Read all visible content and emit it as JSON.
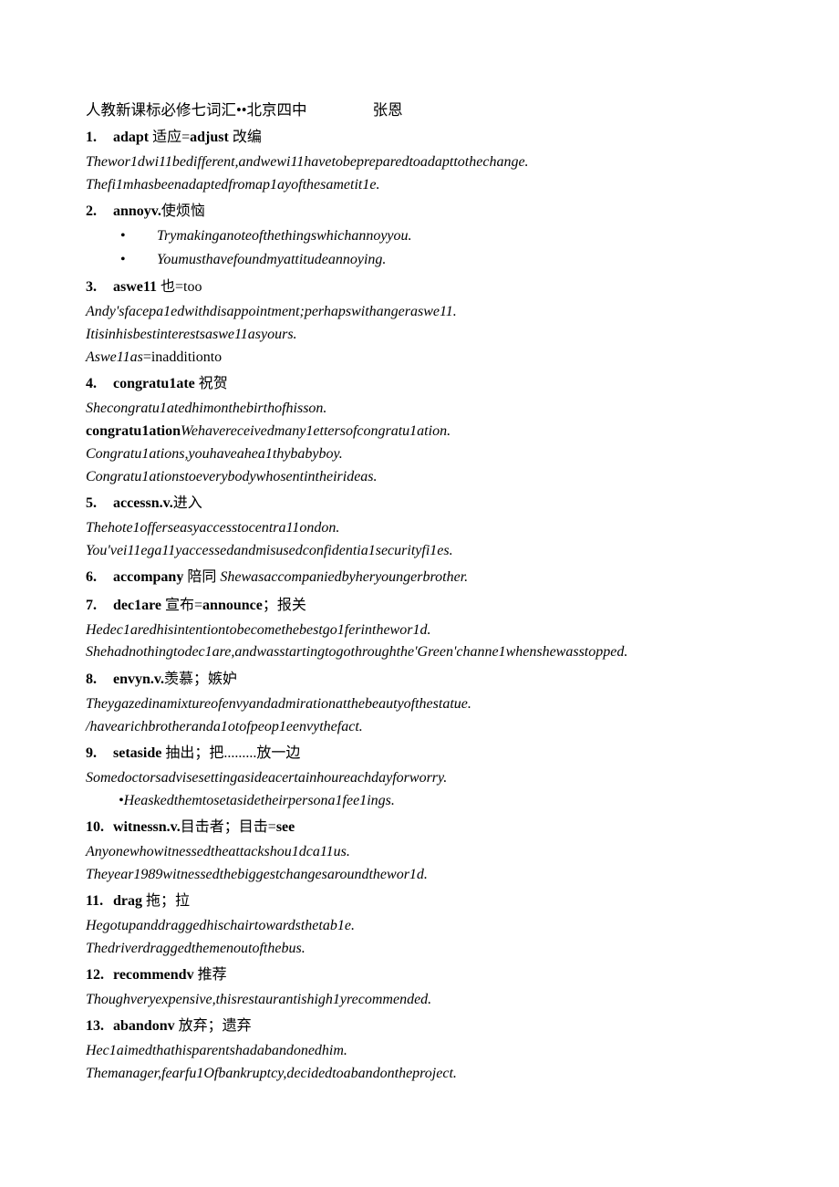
{
  "header": {
    "title": "人教新课标必修七词汇••北京四中",
    "author": "张恩"
  },
  "entries": [
    {
      "num": "1.",
      "word": "adapt",
      "gloss": " 适应=",
      "word2": "adjust",
      "gloss2": " 改编",
      "lines": [
        "Thewor1dwi11bedifferent,andwewi11havetobepreparedtoadapttothechange.",
        "Thefi1mhasbeenadaptedfromap1ayofthesametit1e."
      ]
    },
    {
      "num": "2.",
      "word": "annoyv.",
      "gloss": "使烦恼",
      "bullets": [
        "Trymakinganoteofthethingswhichannoyyou.",
        "Youmusthavefoundmyattitudeannoying."
      ]
    },
    {
      "num": "3.",
      "word": "aswe11",
      "gloss": " 也=too",
      "lines": [
        "Andy'sfacepa1edwithdisappointment;perhapswithangeraswe11.",
        "Itisinhisbestinterestsaswe11asyours."
      ],
      "mixed_line": {
        "italic": "Aswe11as",
        "plain": "=inadditionto"
      }
    },
    {
      "num": "4.",
      "word": "congratu1ate",
      "gloss": " 祝贺",
      "lines": [
        "Shecongratu1atedhimonthebirthofhisson."
      ],
      "runin_line": {
        "bold": "congratu1ation",
        "italic": "Wehavereceivedmany1ettersofcongratu1ation."
      },
      "lines_after": [
        "Congratu1ations,youhaveahea1thybabyboy.",
        "Congratu1ationstoeverybodywhosentintheirideas."
      ]
    },
    {
      "num": "5.",
      "word": "accessn.v.",
      "gloss": "进入",
      "lines": [
        "Thehote1offerseasyaccesstocentra11ondon.",
        "You'vei11ega11yaccessedandmisusedconfidentia1securityfi1es."
      ]
    },
    {
      "num": "6.",
      "word": "accompany",
      "gloss": " 陪同 ",
      "inline_example": "Shewasaccompaniedbyheryoungerbrother."
    },
    {
      "num": "7.",
      "word": "dec1are",
      "gloss": " 宣布=",
      "word2": "announce",
      "gloss2": "；报关",
      "lines": [
        "Hedec1aredhisintentiontobecomethebestgo1ferinthewor1d.",
        "Shehadnothingtodec1are,andwasstartingtogothroughthe'Green'channe1whenshewasstopped."
      ]
    },
    {
      "num": "8.",
      "word": "envyn.v.",
      "gloss": "羡慕；嫉妒",
      "lines": [
        "Theygazedinamixtureofenvyandadmirationatthebeautyofthestatue.",
        "/havearichbrotheranda1otofpeop1eenvythefact."
      ]
    },
    {
      "num": "9.",
      "word": "setaside",
      "gloss": " 抽出；把.........放一边",
      "lines": [
        "Somedoctorsadvisesettingasideacertainhoureachdayforworry."
      ],
      "tight_bullet": "•Heaskedthemtosetasidetheirpersona1fee1ings."
    },
    {
      "num": "10.",
      "word": "witnessn.v.",
      "gloss": "目击者；目击=",
      "word2": "see",
      "lines": [
        "Anyonewhowitnessedtheattackshou1dca11us.",
        "Theyear1989witnessedthebiggestchangesaroundthewor1d."
      ]
    },
    {
      "num": "11.",
      "word": "drag",
      "gloss": " 拖；拉",
      "lines": [
        "Hegotupanddraggedhischairtowardsthetab1e.",
        "Thedriverdraggedthemenoutofthebus."
      ]
    },
    {
      "num": "12.",
      "word": "recommendv",
      "gloss": " 推荐",
      "lines": [
        "Thoughveryexpensive,thisrestaurantishigh1yrecommended."
      ]
    },
    {
      "num": "13.",
      "word": "abandonv",
      "gloss": " 放弃；遗弃",
      "lines": [
        "Hec1aimedthathisparentshadabandonedhim.",
        "Themanager,fearfu1Ofbankruptcy,decidedtoabandontheproject."
      ]
    }
  ]
}
